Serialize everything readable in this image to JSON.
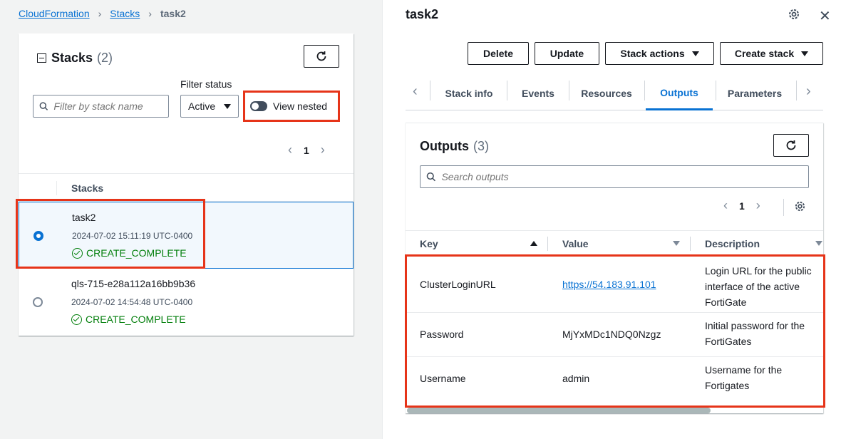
{
  "breadcrumb": {
    "root": "CloudFormation",
    "section": "Stacks",
    "current": "task2"
  },
  "stacks_panel": {
    "title": "Stacks",
    "count": "(2)",
    "filter_label": "Filter status",
    "search_placeholder": "Filter by stack name",
    "status_filter": "Active",
    "view_nested_label": "View nested",
    "page": "1",
    "column_header": "Stacks",
    "rows": [
      {
        "name": "task2",
        "date": "2024-07-02 15:11:19 UTC-0400",
        "status": "CREATE_COMPLETE"
      },
      {
        "name": "qls-715-e28a112a16bb9b36",
        "date": "2024-07-02 14:54:48 UTC-0400",
        "status": "CREATE_COMPLETE"
      }
    ]
  },
  "detail_panel": {
    "title": "task2",
    "buttons": {
      "delete": "Delete",
      "update": "Update",
      "stack_actions": "Stack actions",
      "create_stack": "Create stack"
    },
    "tabs": [
      "Stack info",
      "Events",
      "Resources",
      "Outputs",
      "Parameters"
    ],
    "active_tab": "Outputs",
    "outputs": {
      "title": "Outputs",
      "count": "(3)",
      "search_placeholder": "Search outputs",
      "page": "1",
      "columns": {
        "key": "Key",
        "value": "Value",
        "description": "Description"
      },
      "rows": [
        {
          "key": "ClusterLoginURL",
          "value": "https://54.183.91.101",
          "description": "Login URL for the public interface of the active FortiGate"
        },
        {
          "key": "Password",
          "value": "MjYxMDc1NDQ0Nzgz",
          "description": "Initial password for the FortiGates"
        },
        {
          "key": "Username",
          "value": "admin",
          "description": "Username for the Fortigates"
        }
      ]
    }
  },
  "colors": {
    "link": "#0972d3",
    "success": "#037f0c",
    "highlight": "#e63419"
  }
}
